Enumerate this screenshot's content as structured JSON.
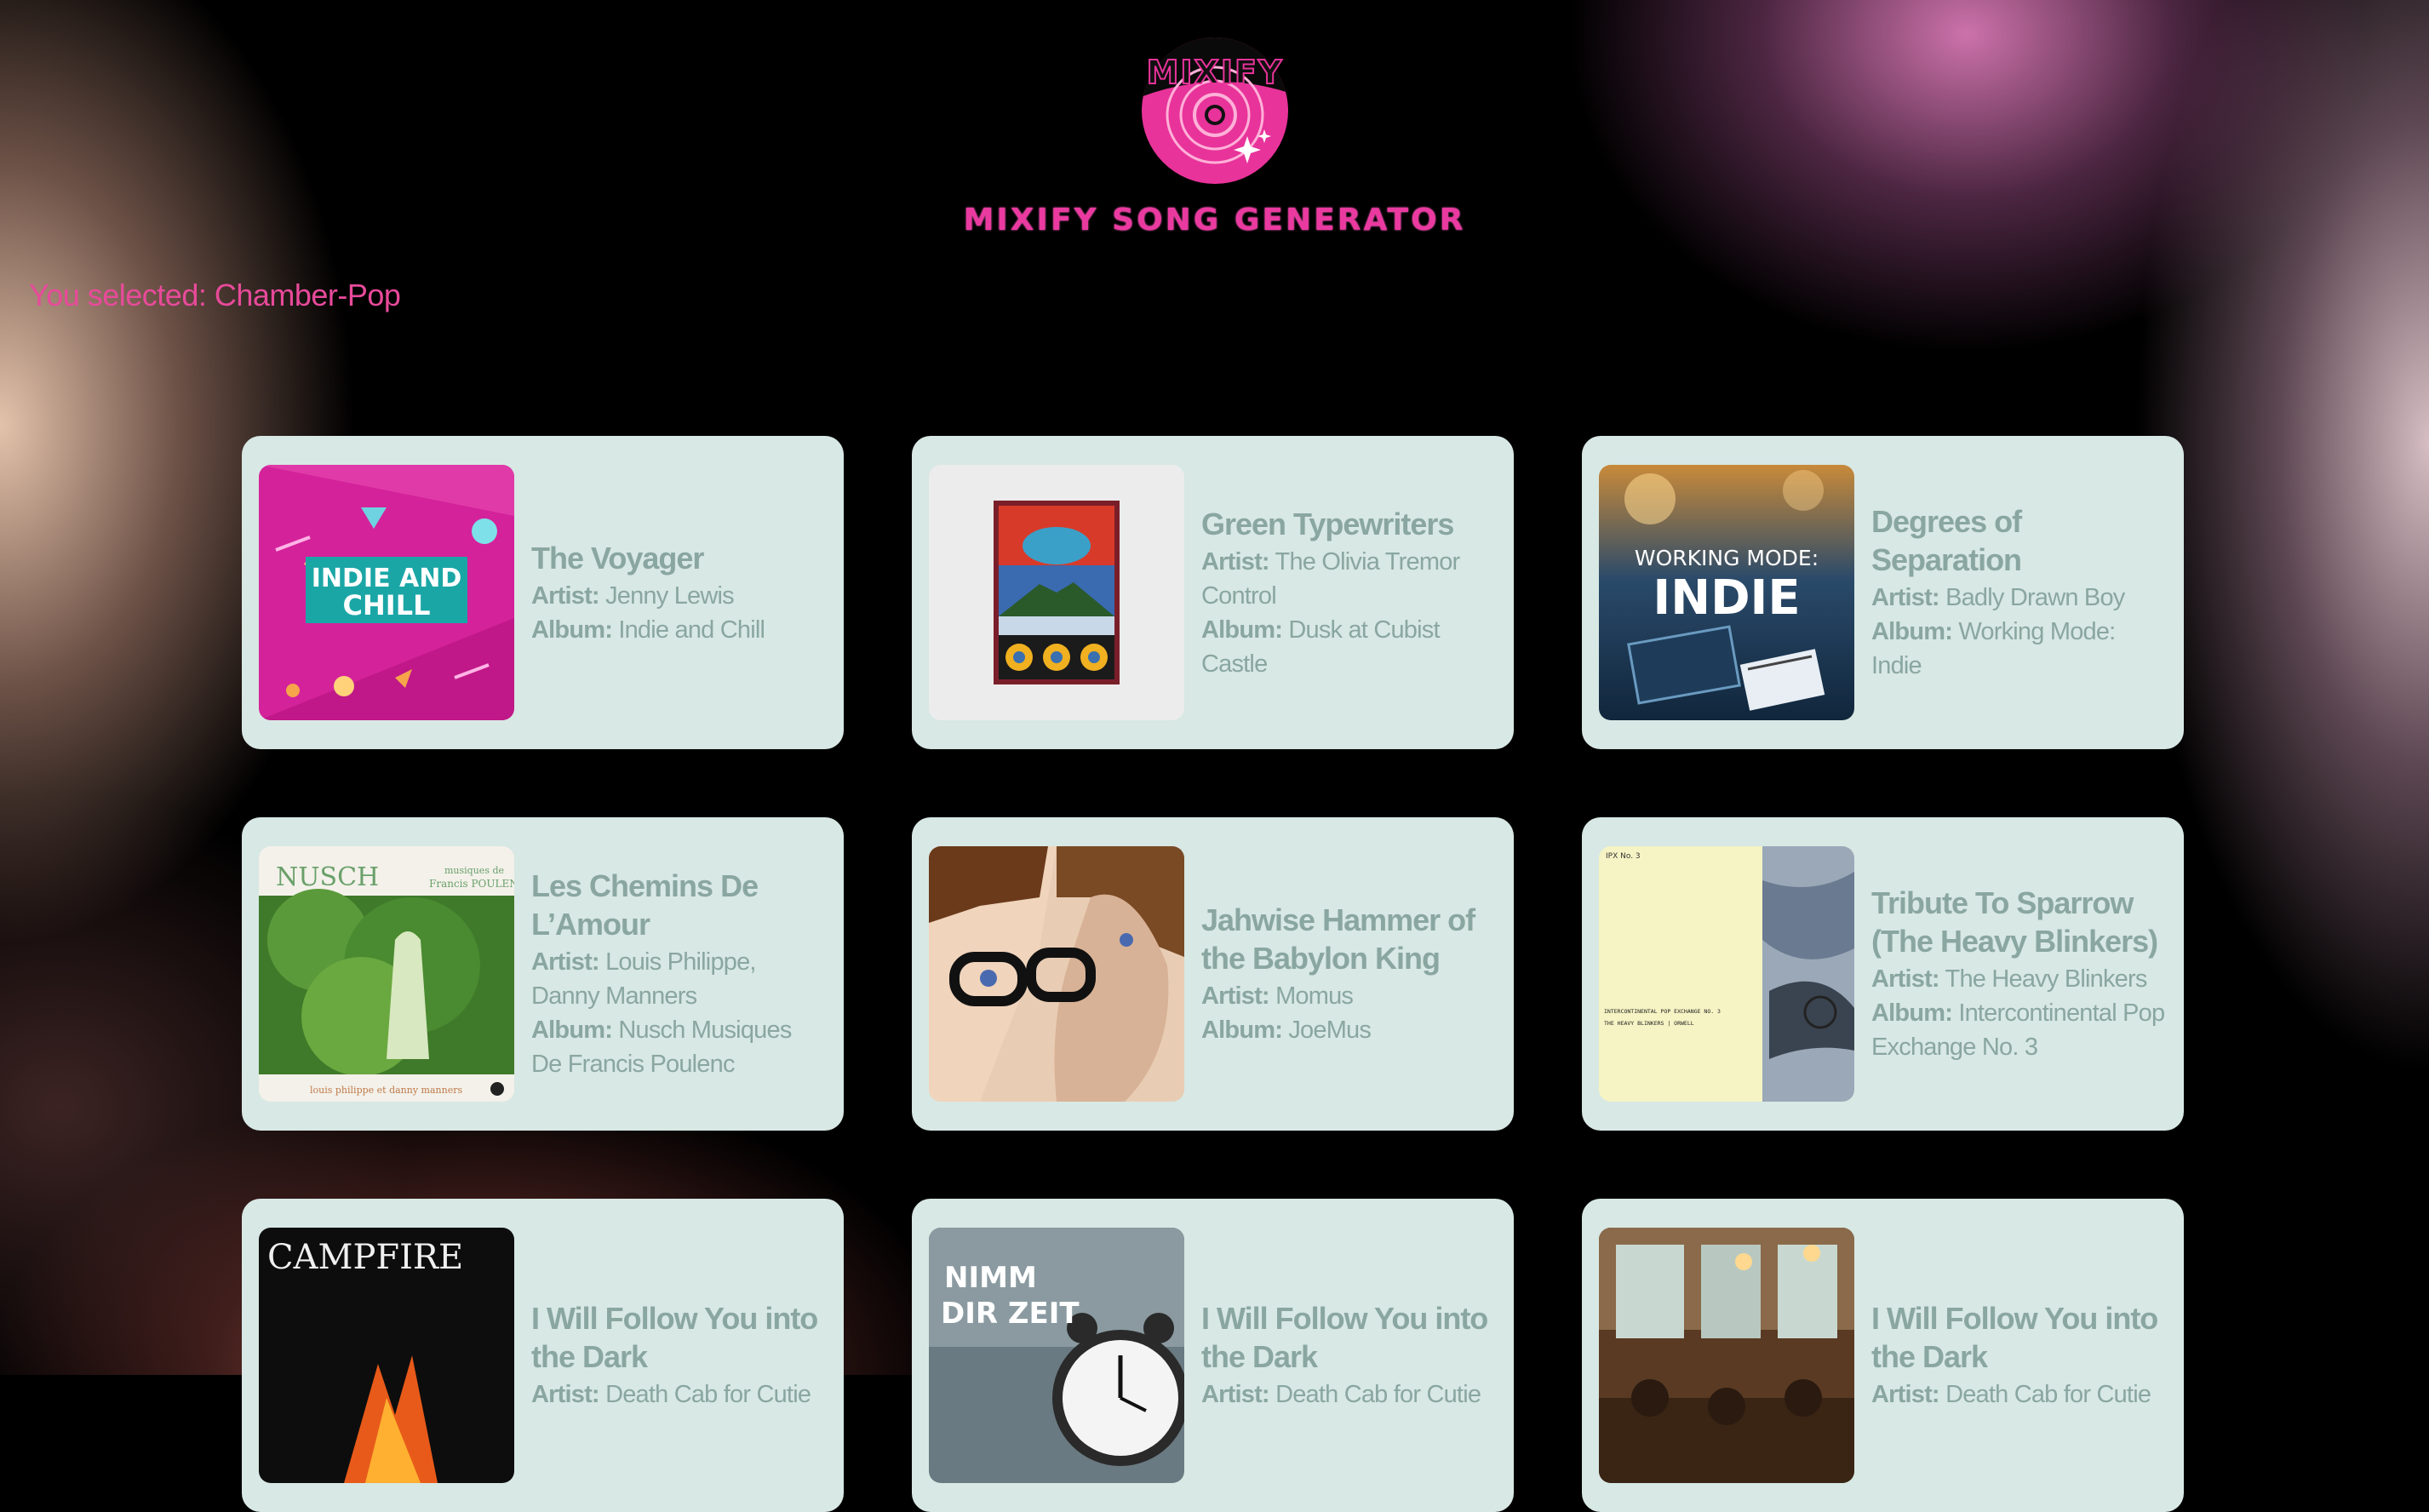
{
  "header": {
    "logo_text": "MIXIFY",
    "title": "MIXIFY SONG GENERATOR"
  },
  "selection": {
    "text": "You selected: Chamber-Pop"
  },
  "labels": {
    "artist": "Artist:",
    "album": "Album:"
  },
  "songs": [
    {
      "title": "The Voyager",
      "artist": "Jenny Lewis",
      "album": "Indie and Chill",
      "cover_text": [
        "INDIE AND",
        "CHILL"
      ]
    },
    {
      "title": "Green Typewriters",
      "artist": "The Olivia Tremor Control",
      "album": "Dusk at Cubist Castle",
      "cover_text": []
    },
    {
      "title": "Degrees of Separation",
      "artist": "Badly Drawn Boy",
      "album": "Working Mode: Indie",
      "cover_text": [
        "WORKING MODE:",
        "INDIE"
      ]
    },
    {
      "title": "Les Chemins De L’Amour",
      "artist": "Louis Philippe, Danny Manners",
      "album": "Nusch Musiques De Francis Poulenc",
      "cover_text": [
        "NUSCH",
        "musiques de",
        "Francis POULENC",
        "louis philippe et danny manners"
      ]
    },
    {
      "title": "Jahwise Hammer of the Babylon King",
      "artist": "Momus",
      "album": "JoeMus",
      "cover_text": []
    },
    {
      "title": "Tribute To Sparrow (The Heavy Blinkers)",
      "artist": "The Heavy Blinkers",
      "album": "Intercontinental Pop Exchange No. 3",
      "cover_text": [
        "IPX No. 3",
        "INTERCONTINENTAL POP EXCHANGE NO. 3",
        "THE HEAVY BLINKERS | ORWELL"
      ]
    },
    {
      "title": "I Will Follow You into the Dark",
      "artist": "Death Cab for Cutie",
      "album": "",
      "cover_text": [
        "CAMPFIRE"
      ]
    },
    {
      "title": "I Will Follow You into the Dark",
      "artist": "Death Cab for Cutie",
      "album": "",
      "cover_text": [
        "NIMM",
        "DIR ZEIT"
      ]
    },
    {
      "title": "I Will Follow You into the Dark",
      "artist": "Death Cab for Cutie",
      "album": "",
      "cover_text": []
    }
  ],
  "colors": {
    "brand_pink": "#ea3aa0",
    "card_bg": "#d8e8e4",
    "card_text": "#8aa6a0",
    "page_bg": "#000000"
  }
}
